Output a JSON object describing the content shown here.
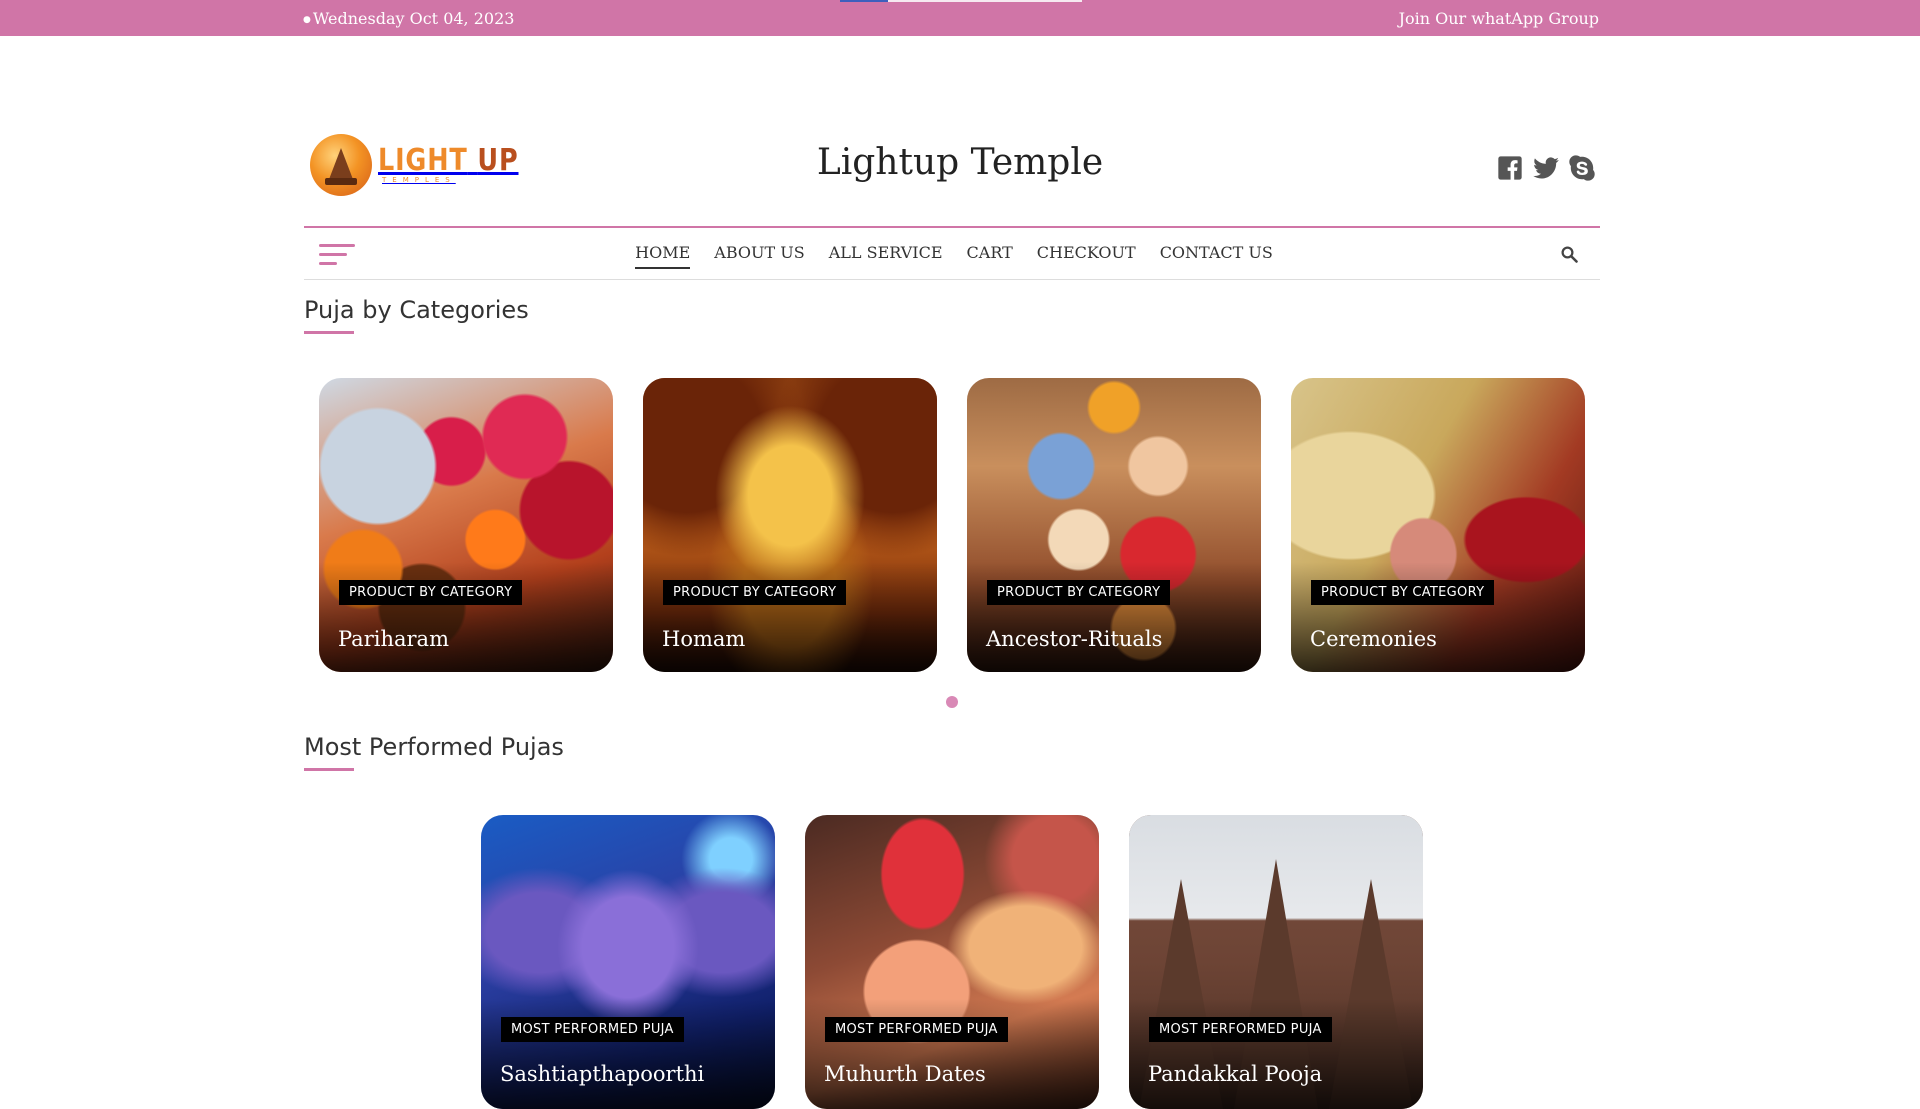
{
  "topbar": {
    "date": "Wednesday Oct 04, 2023",
    "whatsapp": "Join Our whatApp Group",
    "accent_color": "#d075a7"
  },
  "header": {
    "logo": {
      "line1_a": "LIGHT",
      "line1_b": "UP",
      "line2": "TEMPLES"
    },
    "site_title": "Lightup Temple",
    "social": [
      "facebook-icon",
      "twitter-icon",
      "skype-icon"
    ]
  },
  "nav": {
    "items": [
      {
        "label": "HOME",
        "active": true
      },
      {
        "label": "ABOUT US"
      },
      {
        "label": "ALL SERVICE"
      },
      {
        "label": "CART"
      },
      {
        "label": "CHECKOUT"
      },
      {
        "label": "CONTACT US"
      }
    ],
    "search_icon": "search-icon",
    "menu_icon": "hamburger-icon"
  },
  "categories": {
    "title": "Puja by Categories",
    "items": [
      {
        "badge": "PRODUCT BY CATEGORY",
        "name": "Pariharam"
      },
      {
        "badge": "PRODUCT BY CATEGORY",
        "name": "Homam"
      },
      {
        "badge": "PRODUCT BY CATEGORY",
        "name": "Ancestor-Rituals"
      },
      {
        "badge": "PRODUCT BY CATEGORY",
        "name": "Ceremonies"
      }
    ]
  },
  "most_performed": {
    "title": "Most Performed Pujas",
    "items": [
      {
        "badge": "MOST PERFORMED PUJA",
        "name": "Sashtiapthapoorthi"
      },
      {
        "badge": "MOST PERFORMED PUJA",
        "name": "Muhurth Dates"
      },
      {
        "badge": "MOST PERFORMED PUJA",
        "name": "Pandakkal Pooja"
      }
    ]
  }
}
